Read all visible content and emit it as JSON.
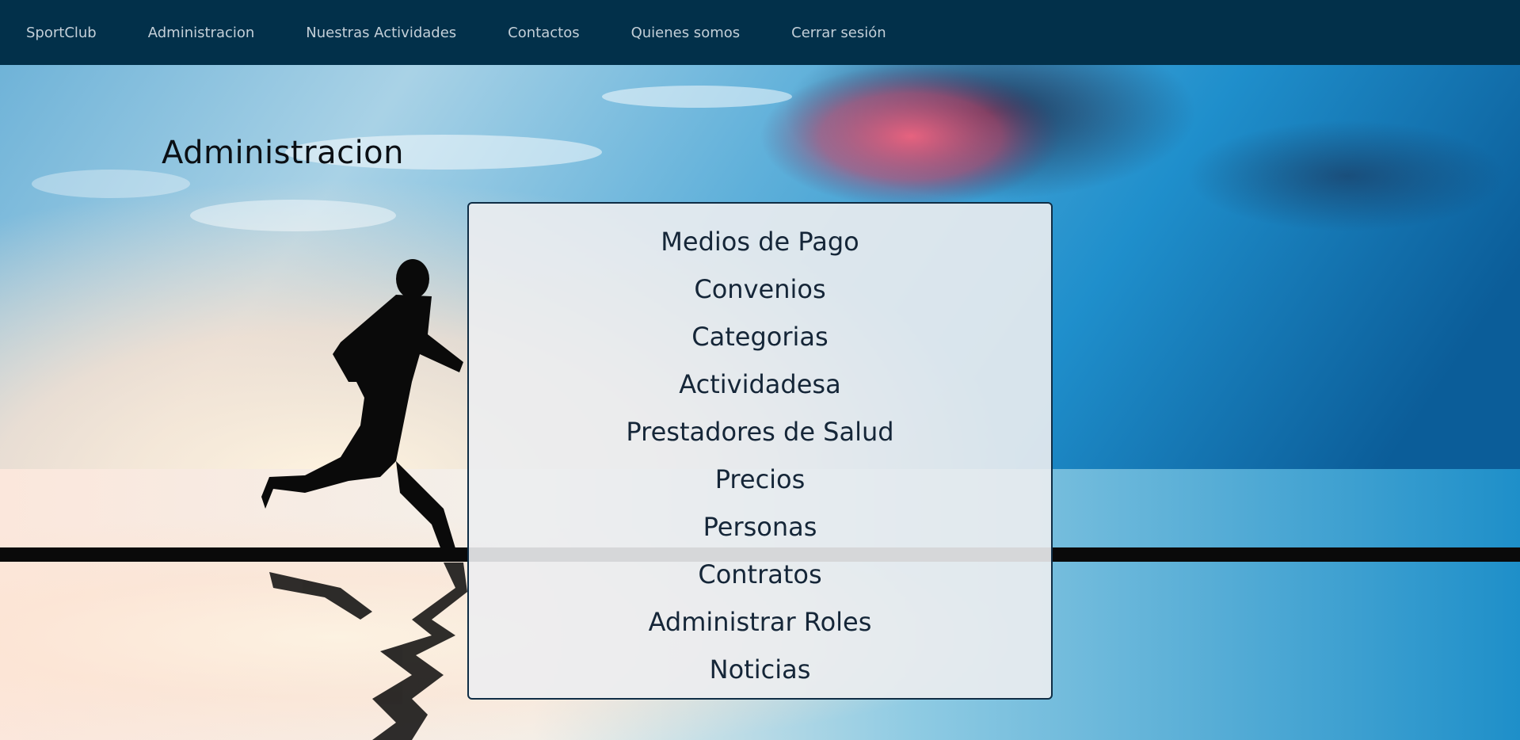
{
  "navbar": {
    "brand": "SportClub",
    "items": [
      {
        "label": "Administracion"
      },
      {
        "label": "Nuestras Actividades"
      },
      {
        "label": "Contactos"
      },
      {
        "label": "Quienes somos"
      },
      {
        "label": "Cerrar sesión"
      }
    ]
  },
  "main": {
    "title": "Administracion",
    "menu": [
      {
        "label": "Medios de Pago"
      },
      {
        "label": "Convenios"
      },
      {
        "label": "Categorias"
      },
      {
        "label": "Actividadesa"
      },
      {
        "label": "Prestadores de Salud"
      },
      {
        "label": "Precios"
      },
      {
        "label": "Personas"
      },
      {
        "label": "Contratos"
      },
      {
        "label": "Administrar Roles"
      },
      {
        "label": "Noticias"
      }
    ]
  },
  "colors": {
    "navbar_bg": "#02304a",
    "navbar_text": "#c3cfd8",
    "panel_border": "#0f2d45",
    "menu_text": "#152638"
  }
}
